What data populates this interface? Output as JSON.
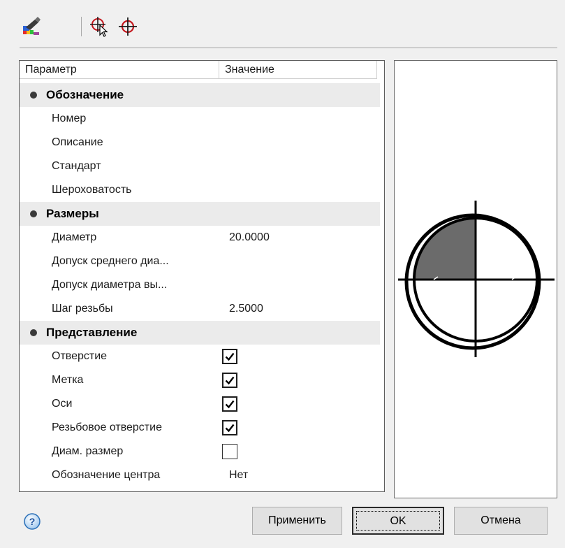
{
  "toolbar": {
    "icons": [
      "brush-color-icon",
      "cursor-select-icon",
      "crosshair-icon"
    ]
  },
  "grid": {
    "header": {
      "param": "Параметр",
      "value": "Значение"
    },
    "categories": [
      {
        "label": "Обозначение",
        "rows": [
          {
            "name": "Номер",
            "value": ""
          },
          {
            "name": "Описание",
            "value": ""
          },
          {
            "name": "Стандарт",
            "value": ""
          },
          {
            "name": "Шероховатость",
            "value": ""
          }
        ]
      },
      {
        "label": "Размеры",
        "rows": [
          {
            "name": "Диаметр",
            "value": "20.0000"
          },
          {
            "name": "Допуск среднего диа...",
            "value": ""
          },
          {
            "name": "Допуск диаметра вы...",
            "value": ""
          },
          {
            "name": "Шаг резьбы",
            "value": "2.5000"
          }
        ]
      },
      {
        "label": "Представление",
        "rows": [
          {
            "name": "Отверстие",
            "checked": true
          },
          {
            "name": "Метка",
            "checked": true
          },
          {
            "name": "Оси",
            "checked": true
          },
          {
            "name": "Резьбовое отверстие",
            "checked": true
          },
          {
            "name": "Диам. размер",
            "checked": false
          },
          {
            "name": "Обозначение центра",
            "value": "Нет"
          }
        ]
      }
    ]
  },
  "preview": {
    "icon": "threaded-hole-preview"
  },
  "buttons": {
    "apply": "Применить",
    "ok": "OK",
    "cancel": "Отмена"
  },
  "help": {
    "icon": "help-icon",
    "glyph": "?"
  },
  "colors": {
    "accent": "#1a73c9",
    "category_bg": "#ebebeb",
    "grid_border": "#5c5c5c"
  }
}
